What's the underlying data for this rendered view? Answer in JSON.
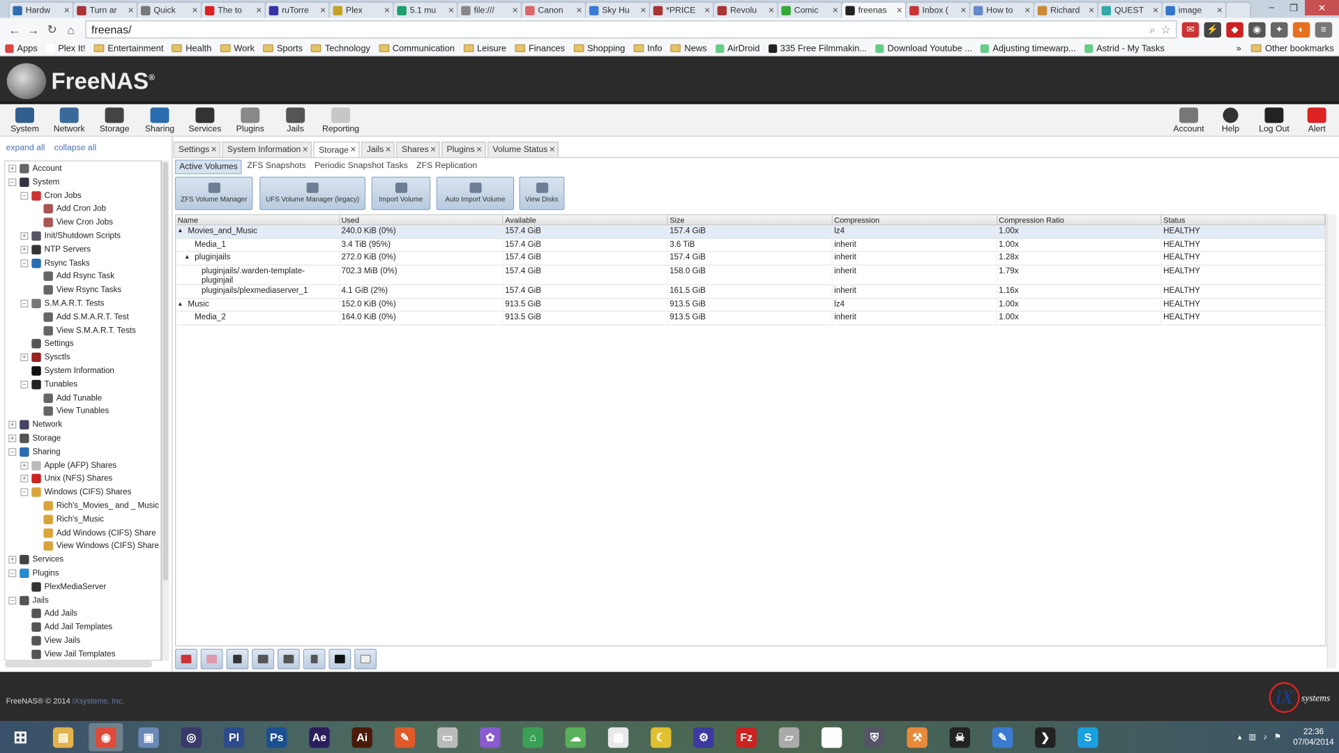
{
  "browser": {
    "tabs": [
      "Hardw",
      "Turn ar",
      "Quick",
      "The to",
      "ruTorre",
      "Plex",
      "5.1 mu",
      "file:///",
      "Canon",
      "Sky Hu",
      "*PRICE",
      "Revolu",
      "Comic",
      "freenas",
      "Inbox (",
      "How to",
      "Richard",
      "QUEST",
      "image"
    ],
    "active_tab_index": 13,
    "address": "freenas/",
    "bookmarks": [
      "Apps",
      "Plex It!",
      "Entertainment",
      "Health",
      "Work",
      "Sports",
      "Technology",
      "Communication",
      "Leisure",
      "Finances",
      "Shopping",
      "Info",
      "News",
      "AirDroid",
      "335 Free Filmmakin...",
      "Download Youtube ...",
      "Adjusting timewarp...",
      "Astrid - My Tasks"
    ],
    "other_bookmarks": "Other bookmarks",
    "overflow": "»"
  },
  "app": {
    "logo_text": "FreeNAS",
    "logo_mark": "®",
    "toolbar": [
      "System",
      "Network",
      "Storage",
      "Sharing",
      "Services",
      "Plugins",
      "Jails",
      "Reporting"
    ],
    "toolbar_right": [
      "Account",
      "Help",
      "Log Out",
      "Alert"
    ]
  },
  "tree": {
    "expand_all": "expand all",
    "collapse_all": "collapse all",
    "nodes": [
      {
        "label": "Account",
        "level": 0,
        "toggle": "+"
      },
      {
        "label": "System",
        "level": 0,
        "toggle": "−"
      },
      {
        "label": "Cron Jobs",
        "level": 1,
        "toggle": "−"
      },
      {
        "label": "Add Cron Job",
        "level": 2,
        "toggle": ""
      },
      {
        "label": "View Cron Jobs",
        "level": 2,
        "toggle": ""
      },
      {
        "label": "Init/Shutdown Scripts",
        "level": 1,
        "toggle": "+"
      },
      {
        "label": "NTP Servers",
        "level": 1,
        "toggle": "+"
      },
      {
        "label": "Rsync Tasks",
        "level": 1,
        "toggle": "−"
      },
      {
        "label": "Add Rsync Task",
        "level": 2,
        "toggle": ""
      },
      {
        "label": "View Rsync Tasks",
        "level": 2,
        "toggle": ""
      },
      {
        "label": "S.M.A.R.T. Tests",
        "level": 1,
        "toggle": "−"
      },
      {
        "label": "Add S.M.A.R.T. Test",
        "level": 2,
        "toggle": ""
      },
      {
        "label": "View S.M.A.R.T. Tests",
        "level": 2,
        "toggle": ""
      },
      {
        "label": "Settings",
        "level": 1,
        "toggle": ""
      },
      {
        "label": "Sysctls",
        "level": 1,
        "toggle": "+"
      },
      {
        "label": "System Information",
        "level": 1,
        "toggle": ""
      },
      {
        "label": "Tunables",
        "level": 1,
        "toggle": "−"
      },
      {
        "label": "Add Tunable",
        "level": 2,
        "toggle": ""
      },
      {
        "label": "View Tunables",
        "level": 2,
        "toggle": ""
      },
      {
        "label": "Network",
        "level": 0,
        "toggle": "+"
      },
      {
        "label": "Storage",
        "level": 0,
        "toggle": "+"
      },
      {
        "label": "Sharing",
        "level": 0,
        "toggle": "−"
      },
      {
        "label": "Apple (AFP) Shares",
        "level": 1,
        "toggle": "+"
      },
      {
        "label": "Unix (NFS) Shares",
        "level": 1,
        "toggle": "+"
      },
      {
        "label": "Windows (CIFS) Shares",
        "level": 1,
        "toggle": "−"
      },
      {
        "label": "Rich's_Movies_ and _ Music",
        "level": 2,
        "toggle": ""
      },
      {
        "label": "Rich's_Music",
        "level": 2,
        "toggle": ""
      },
      {
        "label": "Add Windows (CIFS) Share",
        "level": 2,
        "toggle": ""
      },
      {
        "label": "View Windows (CIFS) Share",
        "level": 2,
        "toggle": ""
      },
      {
        "label": "Services",
        "level": 0,
        "toggle": "+"
      },
      {
        "label": "Plugins",
        "level": 0,
        "toggle": "−"
      },
      {
        "label": "PlexMediaServer",
        "level": 1,
        "toggle": ""
      },
      {
        "label": "Jails",
        "level": 0,
        "toggle": "−"
      },
      {
        "label": "Add Jails",
        "level": 1,
        "toggle": ""
      },
      {
        "label": "Add Jail Templates",
        "level": 1,
        "toggle": ""
      },
      {
        "label": "View Jails",
        "level": 1,
        "toggle": ""
      },
      {
        "label": "View Jail Templates",
        "level": 1,
        "toggle": ""
      }
    ]
  },
  "content_tabs": [
    "Settings",
    "System Information",
    "Storage",
    "Jails",
    "Shares",
    "Plugins",
    "Volume Status"
  ],
  "active_content_tab": "Storage",
  "storage_subtabs": [
    "Active Volumes",
    "ZFS Snapshots",
    "Periodic Snapshot Tasks",
    "ZFS Replication"
  ],
  "action_buttons": [
    "ZFS Volume Manager",
    "UFS Volume Manager (legacy)",
    "Import Volume",
    "Auto Import Volume",
    "View Disks"
  ],
  "grid": {
    "columns": [
      "Name",
      "Used",
      "Available",
      "Size",
      "Compression",
      "Compression Ratio",
      "Status"
    ],
    "rows": [
      {
        "name": "Movies_and_Music",
        "toggle": "▴",
        "indent": 0,
        "used": "240.0 KiB (0%)",
        "available": "157.4 GiB",
        "size": "157.4 GiB",
        "compression": "lz4",
        "ratio": "1.00x",
        "status": "HEALTHY"
      },
      {
        "name": "Media_1",
        "toggle": "",
        "indent": 1,
        "used": "3.4 TiB (95%)",
        "available": "157.4 GiB",
        "size": "3.6 TiB",
        "compression": "inherit",
        "ratio": "1.00x",
        "status": "HEALTHY"
      },
      {
        "name": "pluginjails",
        "toggle": "▴",
        "indent": 1,
        "used": "272.0 KiB (0%)",
        "available": "157.4 GiB",
        "size": "157.4 GiB",
        "compression": "inherit",
        "ratio": "1.28x",
        "status": "HEALTHY"
      },
      {
        "name": "pluginjails/.warden-template-pluginjail",
        "toggle": "",
        "indent": 2,
        "used": "702.3 MiB (0%)",
        "available": "157.4 GiB",
        "size": "158.0 GiB",
        "compression": "inherit",
        "ratio": "1.79x",
        "status": "HEALTHY"
      },
      {
        "name": "pluginjails/plexmediaserver_1",
        "toggle": "",
        "indent": 2,
        "used": "4.1 GiB (2%)",
        "available": "157.4 GiB",
        "size": "161.5 GiB",
        "compression": "inherit",
        "ratio": "1.16x",
        "status": "HEALTHY"
      },
      {
        "name": "Music",
        "toggle": "▴",
        "indent": 0,
        "used": "152.0 KiB (0%)",
        "available": "913.5 GiB",
        "size": "913.5 GiB",
        "compression": "lz4",
        "ratio": "1.00x",
        "status": "HEALTHY"
      },
      {
        "name": "Media_2",
        "toggle": "",
        "indent": 1,
        "used": "164.0 KiB (0%)",
        "available": "913.5 GiB",
        "size": "913.5 GiB",
        "compression": "inherit",
        "ratio": "1.00x",
        "status": "HEALTHY"
      }
    ]
  },
  "footer": {
    "copyright": "FreeNAS® © 2014",
    "company": "iXsystems, Inc.",
    "ix_logo": "iX systems"
  },
  "taskbar": {
    "time": "22:36",
    "date": "07/04/2014",
    "apps": [
      "Start",
      "File Explorer",
      "Chrome",
      "Control Panel",
      "Media Player",
      "Prelude",
      "Photoshop",
      "After Effects",
      "Illustrator",
      "Paint",
      "Drive",
      "Picasa",
      "Home",
      "Cloud",
      "Clapper",
      "Banana",
      "Settings",
      "FileZilla",
      "Scanner",
      "Grid",
      "Shield",
      "Tools",
      "Alien",
      "Notepad",
      "Plex",
      "Skype"
    ]
  },
  "colors": {
    "header_bg": "#2b2b2b",
    "selected_row": "#e3ebf6",
    "link": "#4a6fb5"
  }
}
